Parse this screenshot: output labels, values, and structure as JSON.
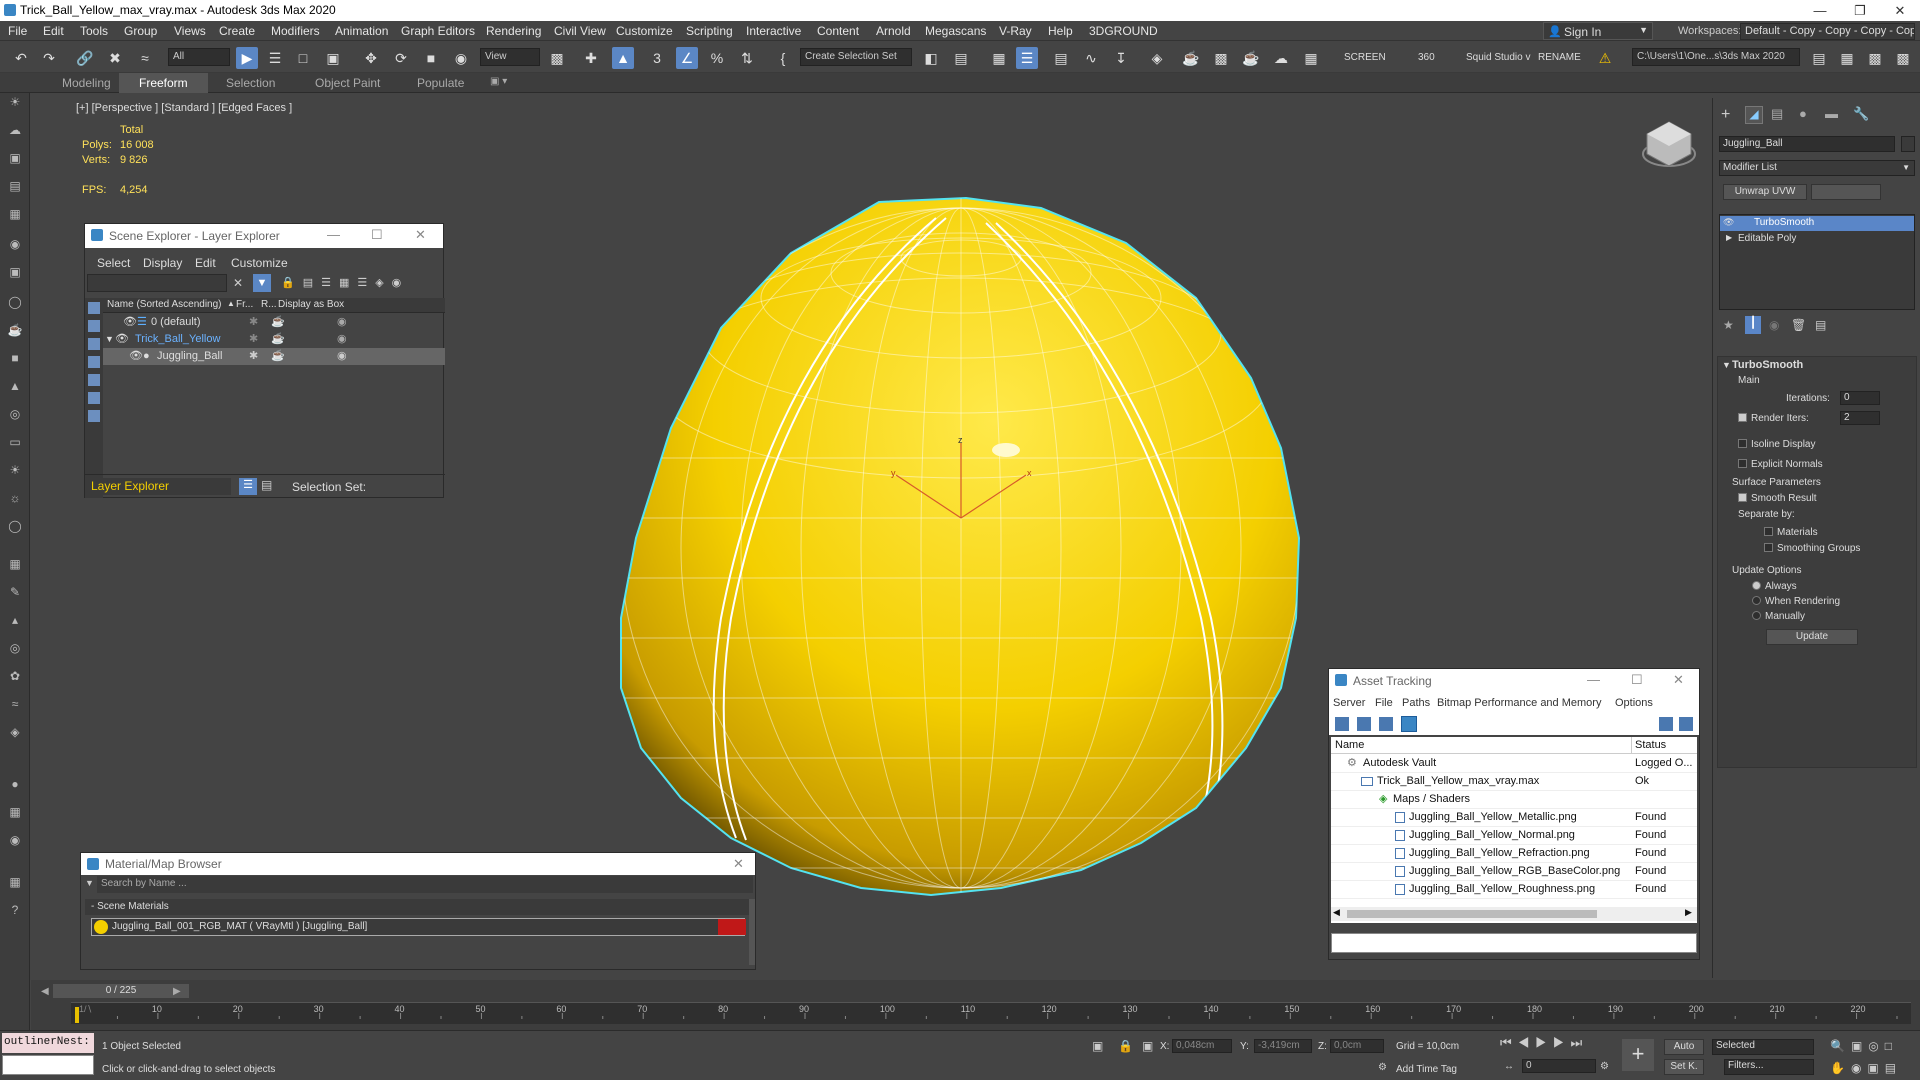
{
  "window": {
    "title": "Trick_Ball_Yellow_max_vray.max - Autodesk 3ds Max 2020"
  },
  "menu": [
    "File",
    "Edit",
    "Tools",
    "Group",
    "Views",
    "Create",
    "Modifiers",
    "Animation",
    "Graph Editors",
    "Rendering",
    "Civil View",
    "Customize",
    "Scripting",
    "Interactive",
    "Content",
    "Arnold",
    "Megascans",
    "V-Ray",
    "Help",
    "3DGROUND"
  ],
  "topright": {
    "sign_in": "Sign In",
    "workspaces_label": "Workspaces:",
    "workspace_value": "Default - Copy - Copy - Copy - Copy"
  },
  "toolbar": {
    "filter": "All",
    "view": "View",
    "selection_set": "Create Selection Set",
    "screen": "SCREEN",
    "deg": "360",
    "squid": "Squid Studio v",
    "rename": "RENAME",
    "path": "C:\\Users\\1\\One...s\\3ds Max 2020"
  },
  "ribbon": {
    "tabs": [
      "Modeling",
      "Freeform",
      "Selection",
      "Object Paint",
      "Populate"
    ],
    "active": "Freeform"
  },
  "viewport": {
    "label": "[+] [Perspective ] [Standard ] [Edged Faces ]",
    "total_label": "Total",
    "polys_label": "Polys:",
    "polys_value": "16 008",
    "verts_label": "Verts:",
    "verts_value": "9 826",
    "fps_label": "FPS:",
    "fps_value": "4,254",
    "axis_x": "x",
    "axis_y": "y",
    "axis_z": "z"
  },
  "scene_explorer": {
    "title": "Scene Explorer - Layer Explorer",
    "menu": [
      "Select",
      "Display",
      "Edit",
      "Customize"
    ],
    "col_name": "Name (Sorted Ascending)",
    "col_fr": "Fr...",
    "col_r": "R...",
    "col_disp": "Display as Box",
    "rows": [
      "0 (default)",
      "Trick_Ball_Yellow",
      "Juggling_Ball"
    ],
    "footer_label": "Layer Explorer",
    "selection_set": "Selection Set:"
  },
  "asset_tracking": {
    "title": "Asset Tracking",
    "menu": [
      "Server",
      "File",
      "Paths",
      "Bitmap Performance and Memory",
      "Options"
    ],
    "col_name": "Name",
    "col_status": "Status",
    "rows": [
      {
        "name": "Autodesk Vault",
        "status": "Logged O..."
      },
      {
        "name": "Trick_Ball_Yellow_max_vray.max",
        "status": "Ok"
      },
      {
        "name": "Maps / Shaders",
        "status": ""
      },
      {
        "name": "Juggling_Ball_Yellow_Metallic.png",
        "status": "Found"
      },
      {
        "name": "Juggling_Ball_Yellow_Normal.png",
        "status": "Found"
      },
      {
        "name": "Juggling_Ball_Yellow_Refraction.png",
        "status": "Found"
      },
      {
        "name": "Juggling_Ball_Yellow_RGB_BaseColor.png",
        "status": "Found"
      },
      {
        "name": "Juggling_Ball_Yellow_Roughness.png",
        "status": "Found"
      }
    ]
  },
  "material_browser": {
    "title": "Material/Map Browser",
    "search": "Search by Name ...",
    "section": "- Scene Materials",
    "item": "Juggling_Ball_001_RGB_MAT  ( VRayMtl )  [Juggling_Ball]"
  },
  "command_panel": {
    "object_name": "Juggling_Ball",
    "modifier_list": "Modifier List",
    "unwrap": "Unwrap UVW",
    "stack": [
      "TurboSmooth",
      "Editable Poly"
    ],
    "rollout": "TurboSmooth",
    "main": "Main",
    "iterations_label": "Iterations:",
    "iterations_value": "0",
    "render_iters_label": "Render Iters:",
    "render_iters_value": "2",
    "isoline": "Isoline Display",
    "explicit": "Explicit Normals",
    "surface": "Surface Parameters",
    "smooth_result": "Smooth Result",
    "separate_by": "Separate by:",
    "materials": "Materials",
    "smoothing_groups": "Smoothing Groups",
    "update_options": "Update Options",
    "always": "Always",
    "when_rendering": "When Rendering",
    "manually": "Manually",
    "update_btn": "Update"
  },
  "timeline": {
    "frame": "0 / 225",
    "ticks": [
      "10",
      "20",
      "30",
      "40",
      "50",
      "60",
      "70",
      "80",
      "90",
      "100",
      "110",
      "120",
      "130",
      "140",
      "150",
      "160",
      "170",
      "180",
      "190",
      "200",
      "210",
      "220"
    ]
  },
  "status": {
    "maxscript": "outlinerNest:",
    "selected": "1 Object Selected",
    "hint": "Click or click-and-drag to select objects",
    "x_label": "X:",
    "x_value": "0,048cm",
    "y_label": "Y:",
    "y_value": "-3,419cm",
    "z_label": "Z:",
    "z_value": "0,0cm",
    "grid": "Grid = 10,0cm",
    "add_time_tag": "Add Time Tag",
    "auto": "Auto",
    "selected_dd": "Selected",
    "setk": "Set K.",
    "filters": "Filters...",
    "frame_field": "0"
  }
}
